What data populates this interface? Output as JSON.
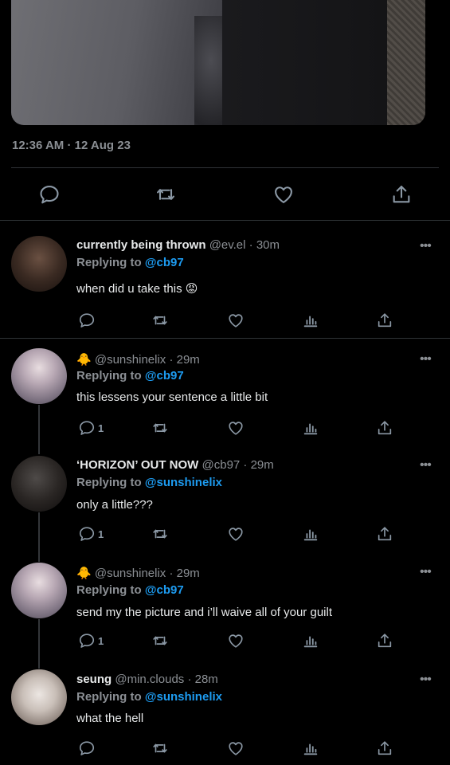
{
  "main_tweet": {
    "timestamp": "12:36 AM · 12 Aug 23",
    "actions": [
      "reply-icon",
      "retweet-icon",
      "like-icon",
      "share-icon"
    ]
  },
  "colors": {
    "background": "#000000",
    "link": "#1d9bf0",
    "muted": "#8b8f94",
    "divider": "#2f3336"
  },
  "replies": [
    {
      "name": "currently being thrown",
      "handle": "@ev.el · 30m",
      "replying_label": "Replying to",
      "replying_to": "@cb97",
      "text": "when did u take this 😡",
      "reply_count": ""
    },
    {
      "name": "🐥",
      "handle": "@sunshinelix · 29m",
      "replying_label": "Replying to",
      "replying_to": "@cb97",
      "text": "this lessens your sentence a little bit",
      "reply_count": "1"
    },
    {
      "name": "‘HORIZON’ OUT NOW",
      "handle": "@cb97 · 29m",
      "replying_label": "Replying to",
      "replying_to": "@sunshinelix",
      "text": "only a little???",
      "reply_count": "1"
    },
    {
      "name": "🐥",
      "handle": "@sunshinelix · 29m",
      "replying_label": "Replying to",
      "replying_to": "@cb97",
      "text": "send my the picture and i’ll waive all of your guilt",
      "reply_count": "1"
    },
    {
      "name": "seung",
      "handle": "@min.clouds · 28m",
      "replying_label": "Replying to",
      "replying_to": "@sunshinelix",
      "text": "what the hell",
      "reply_count": ""
    }
  ]
}
